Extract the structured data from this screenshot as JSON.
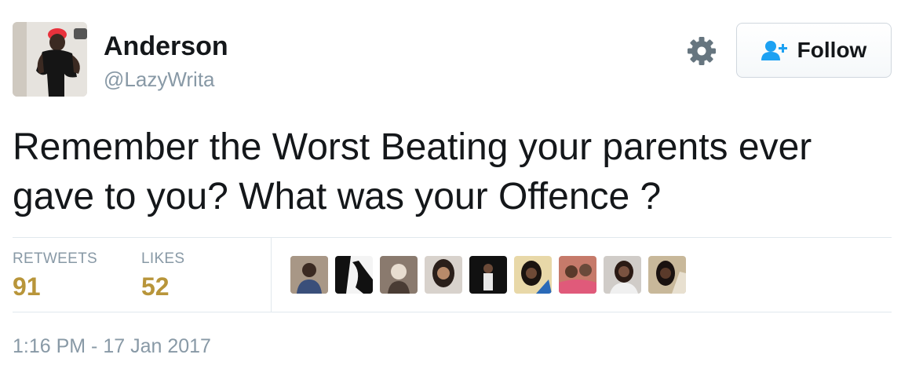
{
  "user": {
    "display_name": "Anderson",
    "handle": "@LazyWrita",
    "avatar_icon": "profile-photo"
  },
  "actions": {
    "follow_label": "Follow",
    "follow_icon": "add-user-icon",
    "settings_icon": "gear-icon"
  },
  "tweet": {
    "text": "Remember the Worst Beating your parents ever gave to you? What was your Offence ?"
  },
  "stats": {
    "retweets_label": "RETWEETS",
    "retweets_value": "91",
    "likes_label": "LIKES",
    "likes_value": "52"
  },
  "likers": [
    {
      "icon": "liker-avatar"
    },
    {
      "icon": "liker-avatar"
    },
    {
      "icon": "liker-avatar"
    },
    {
      "icon": "liker-avatar"
    },
    {
      "icon": "liker-avatar"
    },
    {
      "icon": "liker-avatar"
    },
    {
      "icon": "liker-avatar"
    },
    {
      "icon": "liker-avatar"
    },
    {
      "icon": "liker-avatar"
    }
  ],
  "timestamp": "1:16 PM - 17 Jan 2017",
  "colors": {
    "stat_value": "#b8953a",
    "muted": "#8899a6",
    "text": "#14171a",
    "follow_icon": "#1da1f2"
  }
}
